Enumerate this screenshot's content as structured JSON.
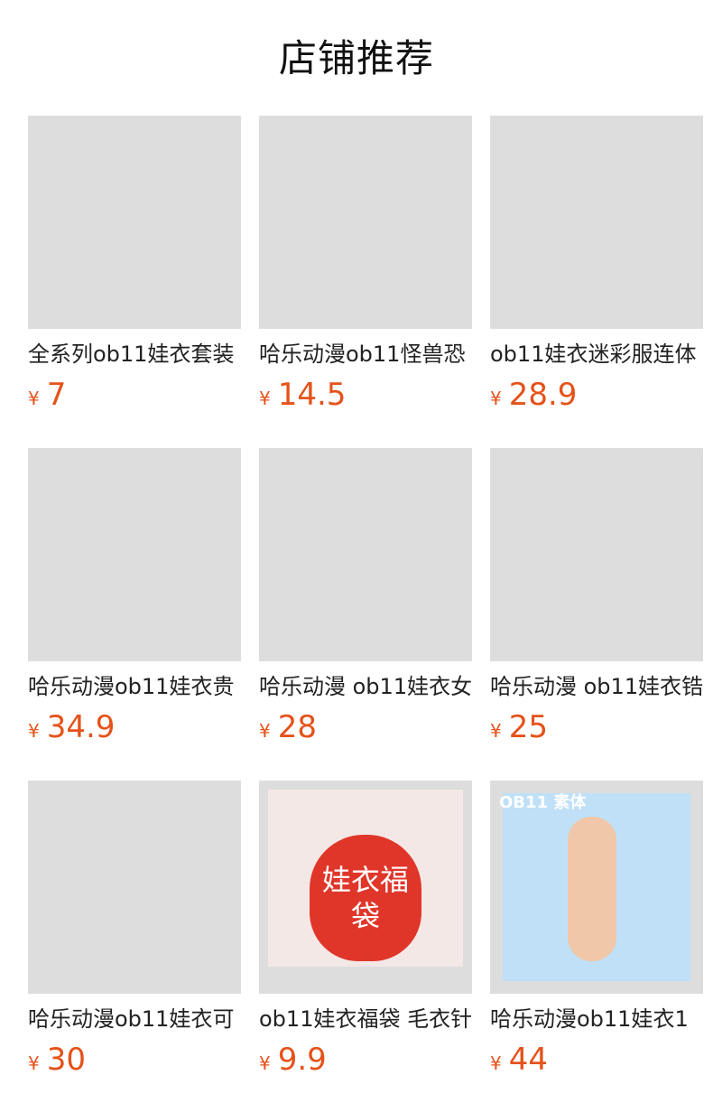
{
  "section": {
    "title": "店铺推荐"
  },
  "products": [
    {
      "title": "全系列ob11娃衣套装",
      "currency": "¥",
      "price": "7"
    },
    {
      "title": "哈乐动漫ob11怪兽恐",
      "currency": "¥",
      "price": "14.5"
    },
    {
      "title": "ob11娃衣迷彩服连体",
      "currency": "¥",
      "price": "28.9"
    },
    {
      "title": "哈乐动漫ob11娃衣贵",
      "currency": "¥",
      "price": "34.9"
    },
    {
      "title": "哈乐动漫 ob11娃衣女",
      "currency": "¥",
      "price": "28"
    },
    {
      "title": "哈乐动漫 ob11娃衣锆",
      "currency": "¥",
      "price": "25"
    },
    {
      "title": "哈乐动漫ob11娃衣可",
      "currency": "¥",
      "price": "30"
    },
    {
      "title": "ob11娃衣福袋 毛衣针",
      "currency": "¥",
      "price": "9.9",
      "image_text": "娃衣福袋"
    },
    {
      "title": "哈乐动漫ob11娃衣1",
      "currency": "¥",
      "price": "44",
      "image_text": "OB11 素体"
    }
  ],
  "colors": {
    "price": "#e5521a",
    "title": "#222222",
    "heading": "#111111"
  }
}
